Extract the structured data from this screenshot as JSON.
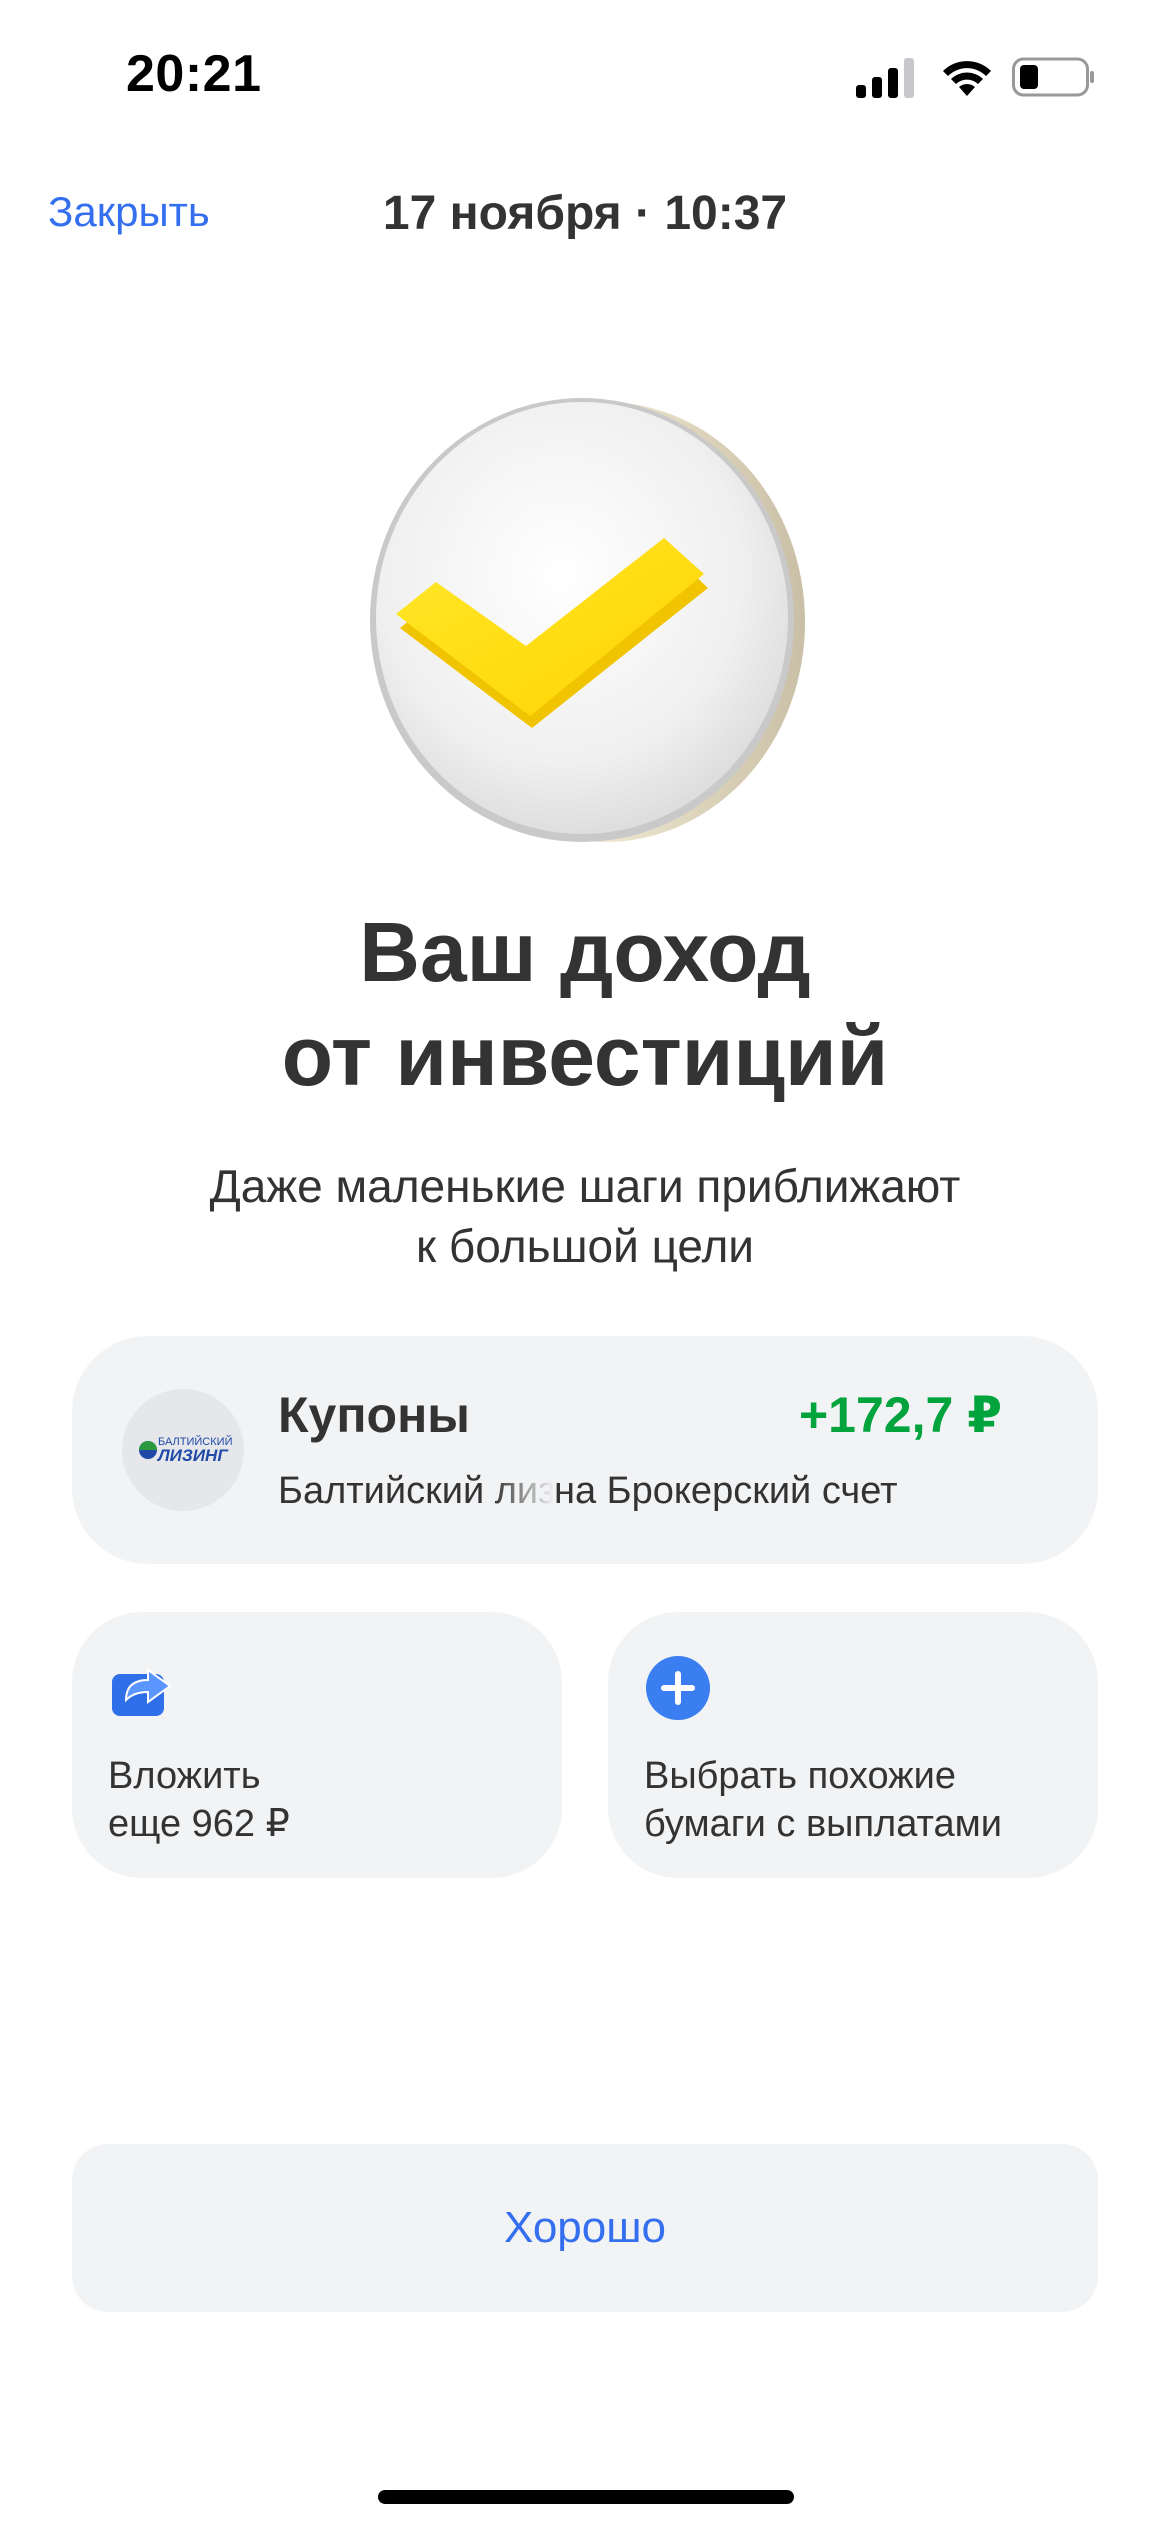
{
  "status_bar": {
    "time": "20:21"
  },
  "header": {
    "close_label": "Закрыть",
    "date": "17 ноября · 10:37"
  },
  "hero": {
    "title_line1": "Ваш доход",
    "title_line2": "от инвестиций",
    "subtitle_line1": "Даже маленькие шаги приближают",
    "subtitle_line2": "к большой цели"
  },
  "coupon": {
    "title": "Купоны",
    "amount": "+172,7 ₽",
    "issuer": "Балтийский лизинг",
    "destination": "на Брокерский счет",
    "logo_text_top": "БАЛТИЙСКИЙ",
    "logo_text_bottom": "ЛИЗИНГ"
  },
  "actions": {
    "invest_line1": "Вложить",
    "invest_line2": "еще 962 ₽",
    "similar_line1": "Выбрать похожие",
    "similar_line2": "бумаги с выплатами"
  },
  "ok_button": {
    "label": "Хорошо"
  },
  "colors": {
    "accent": "#336fee",
    "positive": "#00a33c",
    "card_bg": "#f2f3f5",
    "check_yellow": "#ffdd2d"
  }
}
